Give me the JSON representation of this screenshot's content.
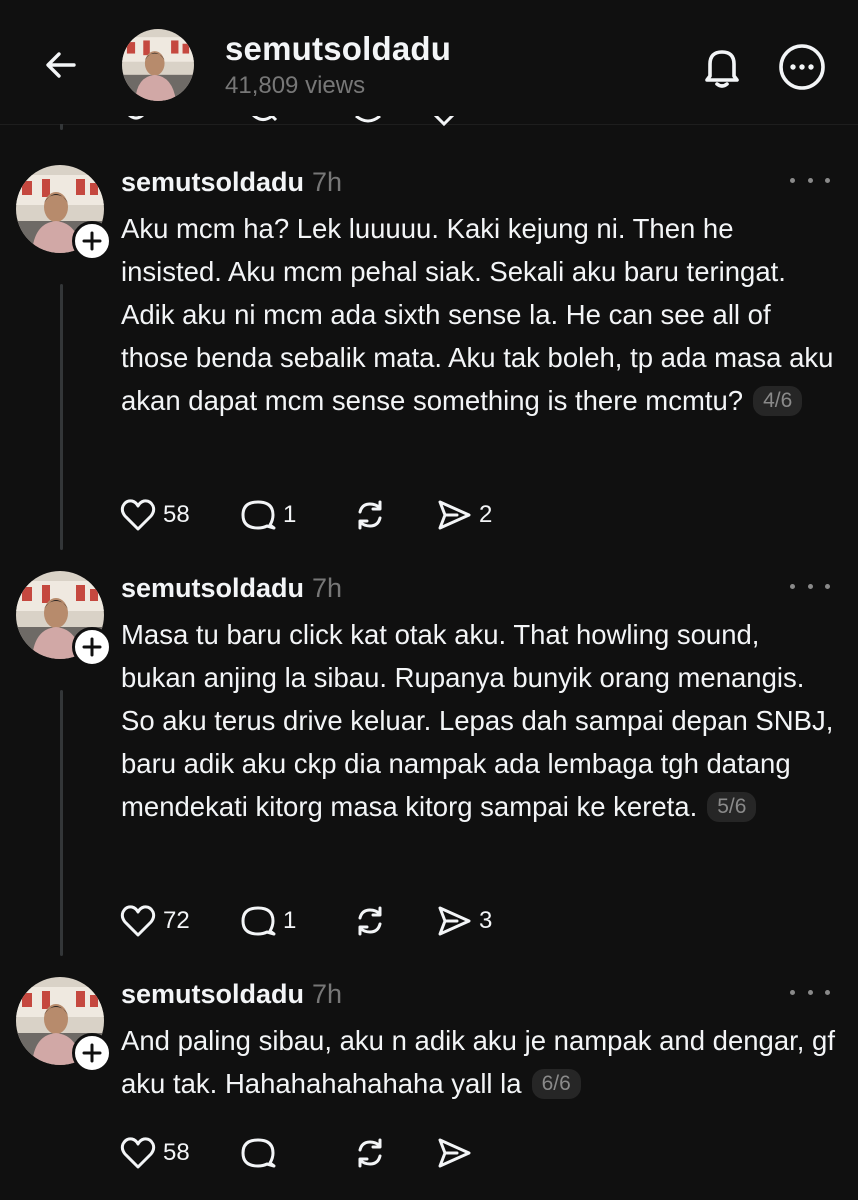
{
  "header": {
    "title": "semutsoldadu",
    "subtitle": "41,809 views",
    "back_icon": "back-arrow-icon",
    "bell_icon": "bell-icon",
    "more_icon": "more-circle-icon"
  },
  "colors": {
    "background": "#101010",
    "text_primary": "#f3f5f7",
    "text_secondary": "#777777",
    "thread_line": "#333638"
  },
  "posts": [
    {
      "username": "semutsoldadu",
      "time": "7h",
      "text": "Aku mcm ha? Lek luuuuu. Kaki kejung ni. Then he insisted. Aku mcm pehal siak. Sekali aku baru teringat. Adik aku ni mcm ada sixth sense la. He can see all of those benda sebalik mata. Aku tak boleh, tp ada masa aku akan dapat mcm sense something is there mcmtu?",
      "counter": "4/6",
      "likes": "58",
      "replies": "1",
      "reposts": "",
      "shares": "2"
    },
    {
      "username": "semutsoldadu",
      "time": "7h",
      "text": "Masa tu baru click kat otak aku. That howling sound, bukan anjing la sibau. Rupanya bunyik orang menangis. So aku terus drive keluar. Lepas dah sampai depan SNBJ, baru adik aku ckp dia nampak ada lembaga tgh datang mendekati kitorg masa kitorg sampai ke kereta.",
      "counter": "5/6",
      "likes": "72",
      "replies": "1",
      "reposts": "",
      "shares": "3"
    },
    {
      "username": "semutsoldadu",
      "time": "7h",
      "text": "And paling sibau, aku n adik aku je nampak and dengar, gf aku tak. Hahahahahahaha yall la",
      "counter": "6/6",
      "likes": "58",
      "replies": "",
      "reposts": "",
      "shares": ""
    }
  ]
}
